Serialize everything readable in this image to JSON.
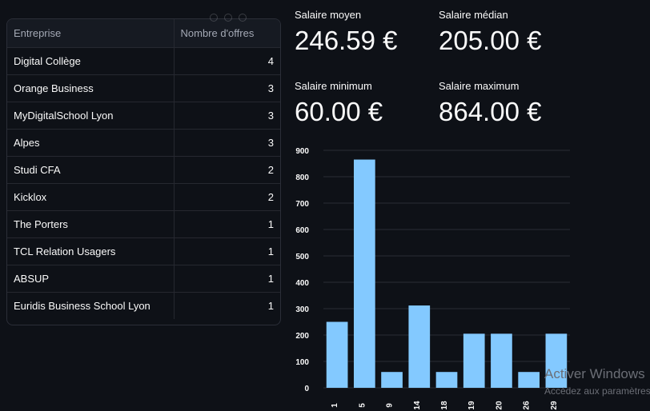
{
  "table": {
    "headers": {
      "company": "Entreprise",
      "count": "Nombre d'offres"
    },
    "rows": [
      {
        "company": "Digital Collège",
        "count": "4"
      },
      {
        "company": "Orange Business",
        "count": "3"
      },
      {
        "company": "MyDigitalSchool Lyon",
        "count": "3"
      },
      {
        "company": "Alpes",
        "count": "3"
      },
      {
        "company": "Studi CFA",
        "count": "2"
      },
      {
        "company": "Kicklox",
        "count": "2"
      },
      {
        "company": "The Porters",
        "count": "1"
      },
      {
        "company": "TCL Relation Usagers",
        "count": "1"
      },
      {
        "company": "ABSUP",
        "count": "1"
      },
      {
        "company": "Euridis Business School Lyon",
        "count": "1"
      }
    ]
  },
  "metrics": {
    "mean": {
      "label": "Salaire moyen",
      "value": "246.59 €"
    },
    "median": {
      "label": "Salaire médian",
      "value": "205.00 €"
    },
    "min": {
      "label": "Salaire minimum",
      "value": "60.00 €"
    },
    "max": {
      "label": "Salaire maximum",
      "value": "864.00 €"
    }
  },
  "chart_data": {
    "type": "bar",
    "categories": [
      "1",
      "5",
      "9",
      "14",
      "18",
      "19",
      "20",
      "26",
      "29"
    ],
    "values": [
      250,
      865,
      60,
      312,
      60,
      205,
      205,
      60,
      205
    ],
    "ylim": [
      0,
      900
    ],
    "yticks": [
      0,
      100,
      200,
      300,
      400,
      500,
      600,
      700,
      800,
      900
    ],
    "bar_color": "#83c9ff",
    "grid": true
  },
  "watermark": {
    "title": "Activer Windows",
    "subtitle": "Accédez aux paramètres"
  }
}
